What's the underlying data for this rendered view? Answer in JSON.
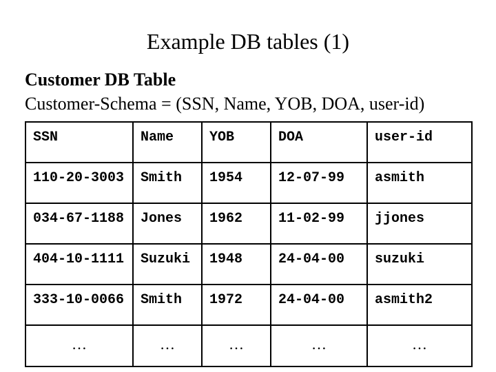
{
  "title": "Example DB tables (1)",
  "subtitle_bold": "Customer DB Table",
  "subtitle_line": "Customer-Schema = (SSN, Name, YOB, DOA, user-id)",
  "table": {
    "headers": [
      "SSN",
      "Name",
      "YOB",
      "DOA",
      "user-id"
    ],
    "rows": [
      [
        "110-20-3003",
        "Smith",
        "1954",
        "12-07-99",
        "asmith"
      ],
      [
        "034-67-1188",
        "Jones",
        "1962",
        "11-02-99",
        "jjones"
      ],
      [
        "404-10-1111",
        "Suzuki",
        "1948",
        "24-04-00",
        "suzuki"
      ],
      [
        "333-10-0066",
        "Smith",
        "1972",
        "24-04-00",
        "asmith2"
      ]
    ],
    "ellipsis": "…"
  }
}
